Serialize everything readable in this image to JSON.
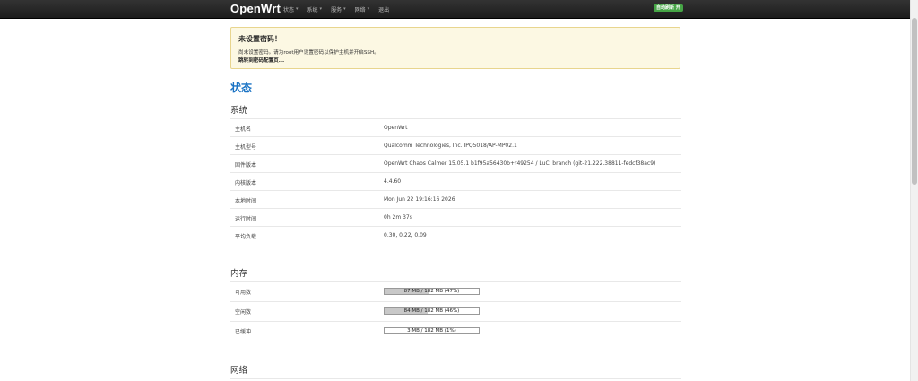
{
  "navbar": {
    "brand": "OpenWrt",
    "items": [
      {
        "label": "状态",
        "dropdown": true
      },
      {
        "label": "系统",
        "dropdown": true
      },
      {
        "label": "服务",
        "dropdown": true
      },
      {
        "label": "网络",
        "dropdown": true
      },
      {
        "label": "退出",
        "dropdown": false
      }
    ],
    "caret": "▾",
    "badge": "自动刷新 开"
  },
  "alert": {
    "title": "未设置密码！",
    "text": "尚未设置密码。请为root用户设置密码以保护主机并开启SSH。",
    "link": "跳转到密码配置页..."
  },
  "page": {
    "title": "状态"
  },
  "system": {
    "title": "系统",
    "rows": [
      {
        "label": "主机名",
        "value": "OpenWrt"
      },
      {
        "label": "主机型号",
        "value": "Qualcomm Technologies, Inc. IPQ5018/AP-MP02.1"
      },
      {
        "label": "固件版本",
        "value": "OpenWrt Chaos Calmer 15.05.1 b1f95a56430b+r49254 / LuCI branch (git-21.222.38811-fedcf38ac9)"
      },
      {
        "label": "内核版本",
        "value": "4.4.60"
      },
      {
        "label": "本地时间",
        "value": "Mon Jun 22 19:16:16 2026"
      },
      {
        "label": "运行时间",
        "value": "0h 2m 37s"
      },
      {
        "label": "平均负载",
        "value": "0.30, 0.22, 0.09"
      }
    ]
  },
  "memory": {
    "title": "内存",
    "rows": [
      {
        "label": "可用数",
        "text": "87 MB / 182 MB (47%)",
        "percent": 47
      },
      {
        "label": "空闲数",
        "text": "84 MB / 182 MB (46%)",
        "percent": 46
      },
      {
        "label": "已缓冲",
        "text": "3 MB / 182 MB (1%)",
        "percent": 1
      }
    ]
  },
  "network": {
    "title": "网络"
  }
}
